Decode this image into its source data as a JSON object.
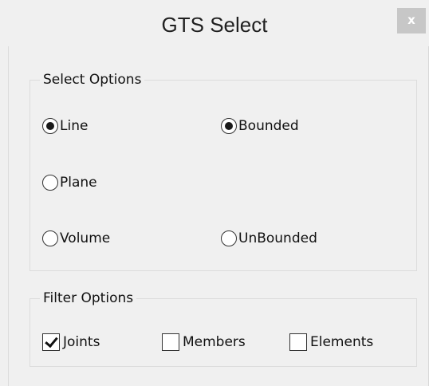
{
  "window": {
    "title": "GTS Select",
    "close_label": "x"
  },
  "select_options": {
    "label": "Select Options",
    "type_options": [
      {
        "label": "Line",
        "checked": true
      },
      {
        "label": "Plane",
        "checked": false
      },
      {
        "label": "Volume",
        "checked": false
      }
    ],
    "bound_options": [
      {
        "label": "Bounded",
        "checked": true
      },
      {
        "label": "UnBounded",
        "checked": false
      }
    ]
  },
  "filter_options": {
    "label": "Filter Options",
    "items": [
      {
        "label": "Joints",
        "checked": true
      },
      {
        "label": "Members",
        "checked": false
      },
      {
        "label": "Elements",
        "checked": false
      }
    ]
  }
}
